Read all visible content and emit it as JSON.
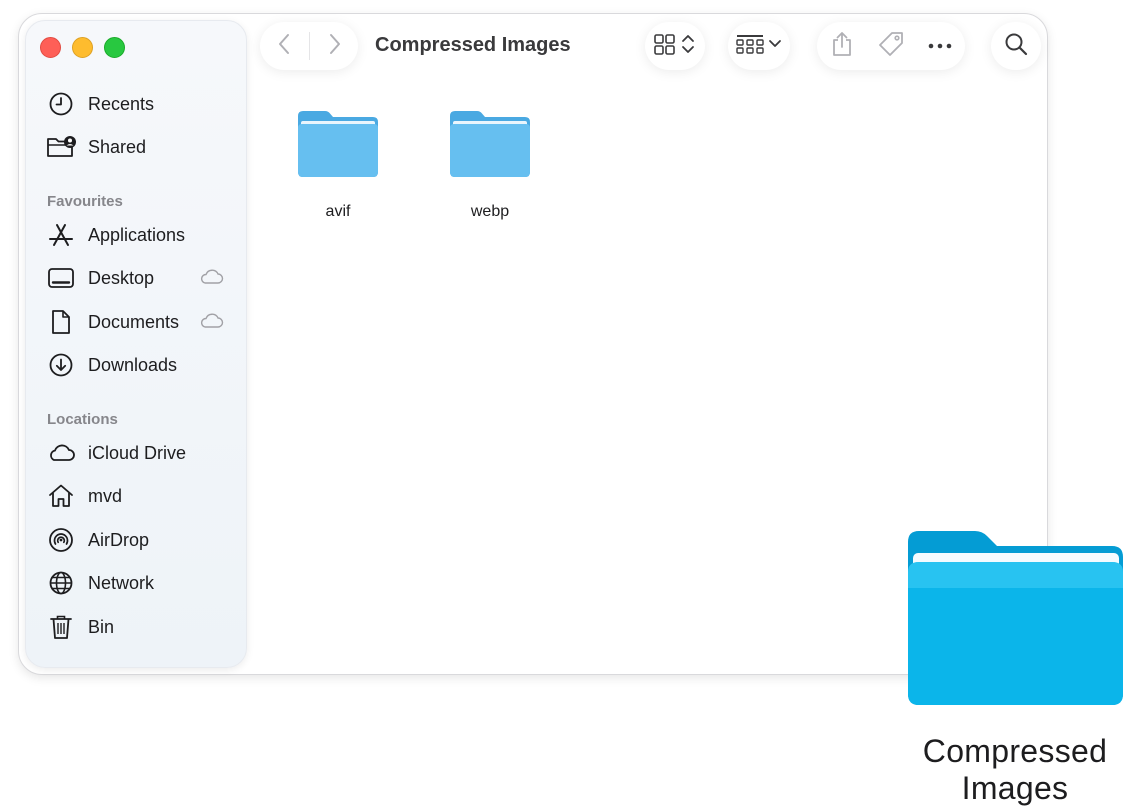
{
  "window": {
    "title": "Compressed Images"
  },
  "sidebar": {
    "top_items": [
      {
        "label": "Recents",
        "icon": "clock-icon"
      },
      {
        "label": "Shared",
        "icon": "shared-folder-icon"
      }
    ],
    "favourites_heading": "Favourites",
    "favourites": [
      {
        "label": "Applications",
        "icon": "applications-icon"
      },
      {
        "label": "Desktop",
        "icon": "desktop-icon",
        "cloud": true
      },
      {
        "label": "Documents",
        "icon": "document-icon",
        "cloud": true
      },
      {
        "label": "Downloads",
        "icon": "download-icon"
      }
    ],
    "locations_heading": "Locations",
    "locations": [
      {
        "label": "iCloud Drive",
        "icon": "cloud-icon"
      },
      {
        "label": "mvd",
        "icon": "home-icon"
      },
      {
        "label": "AirDrop",
        "icon": "airdrop-icon"
      },
      {
        "label": "Network",
        "icon": "globe-icon"
      },
      {
        "label": "Bin",
        "icon": "trash-icon"
      }
    ]
  },
  "toolbar": {
    "back_icon": "chevron-left-icon",
    "forward_icon": "chevron-right-icon",
    "view_icon": "icon-grid-icon",
    "group_icon": "group-grid-icon",
    "share_icon": "share-icon",
    "tag_icon": "tag-icon",
    "more_icon": "ellipsis-icon",
    "search_icon": "search-icon"
  },
  "content": {
    "folders": [
      {
        "name": "avif"
      },
      {
        "name": "webp"
      }
    ]
  },
  "desktop_folder": {
    "label": "Compressed Images"
  },
  "colors": {
    "folder_blue": "#5fb8ec",
    "big_folder_blue": "#09b4ea",
    "traffic_red": "#fe5f57",
    "traffic_yellow": "#febc2e",
    "traffic_green": "#28c840"
  }
}
